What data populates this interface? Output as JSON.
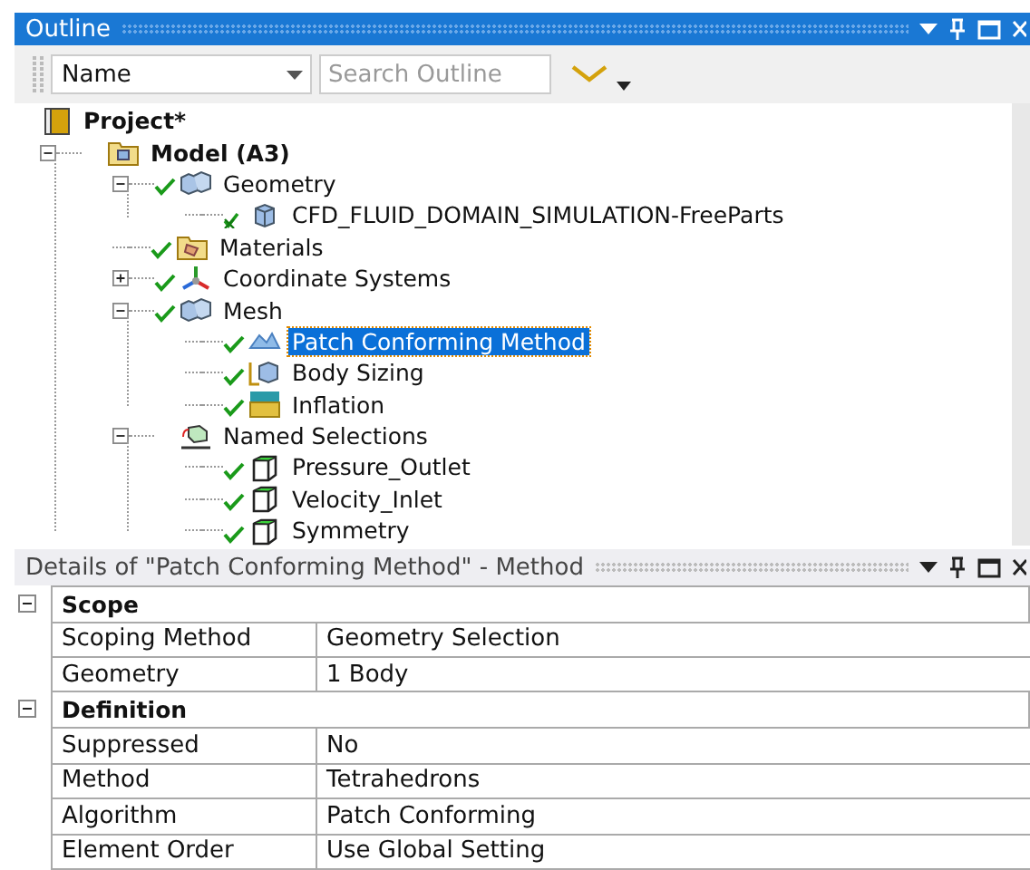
{
  "outline": {
    "title": "Outline",
    "toolbar": {
      "sort_field": "Name",
      "search": {
        "placeholder": "Search Outline"
      }
    },
    "tree": [
      {
        "label": "Project*",
        "kind": "project",
        "selected": false,
        "children": [
          {
            "label": "Model (A3)",
            "kind": "model",
            "expanded": true,
            "selected": false,
            "children": [
              {
                "label": "Geometry",
                "kind": "geometry",
                "checked": true,
                "expanded": true,
                "selected": false,
                "children": [
                  {
                    "label": "CFD_FLUID_DOMAIN_SIMULATION-FreeParts",
                    "kind": "body",
                    "checked": true,
                    "selected": false
                  }
                ]
              },
              {
                "label": "Materials",
                "kind": "materials",
                "checked": true,
                "selected": false
              },
              {
                "label": "Coordinate Systems",
                "kind": "coordinates",
                "checked": true,
                "expanded": false,
                "selected": false
              },
              {
                "label": "Mesh",
                "kind": "mesh",
                "checked": true,
                "expanded": true,
                "selected": false,
                "children": [
                  {
                    "label": "Patch Conforming Method",
                    "kind": "method",
                    "checked": true,
                    "selected": true
                  },
                  {
                    "label": "Body Sizing",
                    "kind": "sizing",
                    "checked": true,
                    "selected": false
                  },
                  {
                    "label": "Inflation",
                    "kind": "inflation",
                    "checked": true,
                    "selected": false
                  }
                ]
              },
              {
                "label": "Named Selections",
                "kind": "named-selections",
                "checked": false,
                "expanded": true,
                "selected": false,
                "children": [
                  {
                    "label": "Pressure_Outlet",
                    "kind": "selection",
                    "checked": true,
                    "selected": false
                  },
                  {
                    "label": "Velocity_Inlet",
                    "kind": "selection",
                    "checked": true,
                    "selected": false
                  },
                  {
                    "label": "Symmetry",
                    "kind": "selection",
                    "checked": true,
                    "selected": false
                  }
                ]
              }
            ]
          }
        ]
      }
    ]
  },
  "details": {
    "title": "Details of \"Patch Conforming Method\" - Method",
    "sections": [
      {
        "title": "Scope",
        "expanded": true,
        "rows": [
          {
            "label": "Scoping Method",
            "value": "Geometry Selection"
          },
          {
            "label": "Geometry",
            "value": "1 Body"
          }
        ]
      },
      {
        "title": "Definition",
        "expanded": true,
        "rows": [
          {
            "label": "Suppressed",
            "value": "No"
          },
          {
            "label": "Method",
            "value": "Tetrahedrons"
          },
          {
            "label": "Algorithm",
            "value": "Patch Conforming"
          },
          {
            "label": "Element Order",
            "value": "Use Global Setting"
          }
        ]
      }
    ]
  }
}
